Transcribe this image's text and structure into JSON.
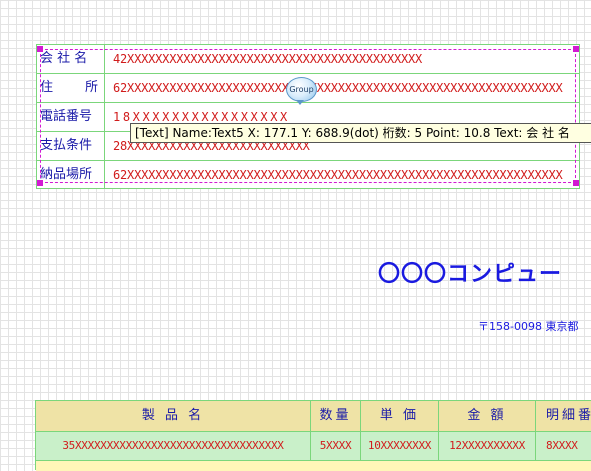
{
  "form": {
    "rows": [
      {
        "label": "会 社 名",
        "value": "42XXXXXXXXXXXXXXXXXXXXXXXXXXXXXXXXXXXXXXXXXX"
      },
      {
        "label": "住　　所",
        "value": "62XXXXXXXXXXXXXXXXXXXXXXXXXXXXXXXXXXXXXXXXXXXXXXXXXXXXXXXXXXXXXX"
      },
      {
        "label": "電話番号",
        "value": "18XXXXXXXXXXXXXXXX"
      },
      {
        "label": "支払条件",
        "value": "28XXXXXXXXXXXXXXXXXXXXXXXXXX"
      },
      {
        "label": "納品場所",
        "value": "62XXXXXXXXXXXXXXXXXXXXXXXXXXXXXXXXXXXXXXXXXXXXXXXXXXXXXXXXXXXXXX"
      }
    ]
  },
  "group_badge": "Group",
  "tooltip": "[Text] Name:Text5 X: 177.1 Y: 688.9(dot) 桁数: 5 Point: 10.8 Text: 会 社 名",
  "company_name": "〇〇〇コンピュー",
  "address": "〒158-0098 東京都",
  "table": {
    "headers": [
      "製 品 名",
      "数量",
      "単 価",
      "金 額",
      "明細番"
    ],
    "row": [
      "35XXXXXXXXXXXXXXXXXXXXXXXXXXXXXXXXX",
      "5XXXX",
      "10XXXXXXXX",
      "12XXXXXXXXXX",
      "8XXXX"
    ]
  },
  "colors": {
    "label": "#1a1aa8",
    "value": "#d11b1b",
    "selection": "#d21ad2",
    "border": "#7bd67b",
    "header_bg": "#efe3a6",
    "row_bg": "#c9f0c9",
    "company": "#1a1ae0"
  }
}
